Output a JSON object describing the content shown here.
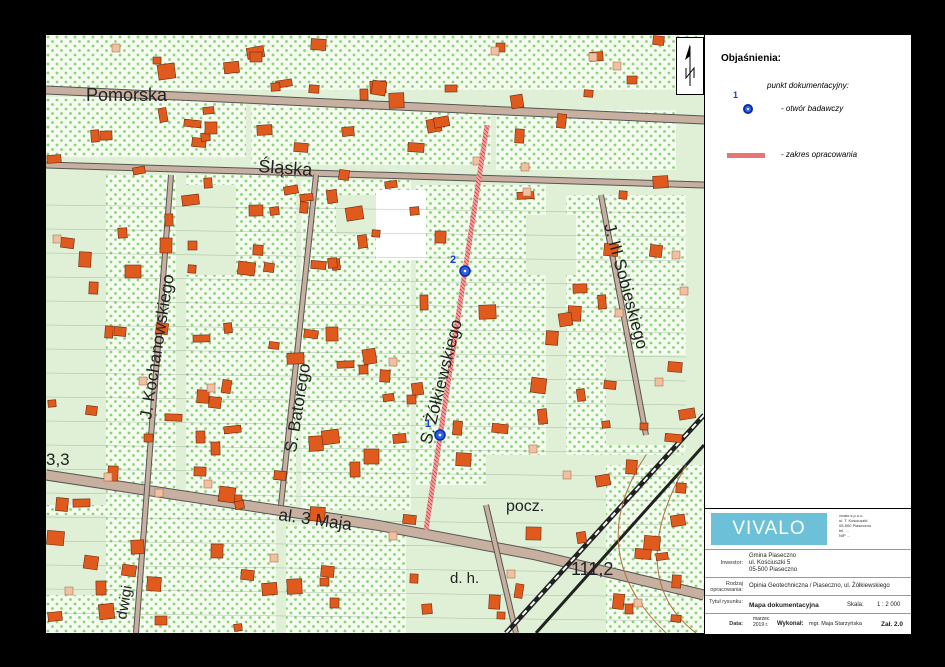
{
  "map": {
    "streets": {
      "pomorska": "Pomorska",
      "slaska": "Śląska",
      "kochanowskiego": "J. Kochanowskiego",
      "batorego": "S. Batorego",
      "zolkiewskiego": "S. Żółkiewskiego",
      "sobieskiego": "J. III Sobieskiego",
      "maja": "al. 3 Maja",
      "pocz": "pocz.",
      "dh": "d. h.",
      "elev1": "111,2",
      "elev2": "3,3",
      "ludwigi": "dwigi"
    },
    "points": [
      {
        "label": "1"
      },
      {
        "label": "2"
      }
    ],
    "colors": {
      "survey_line": "#e06060",
      "point": "#2d5fe0",
      "building": "#e05a1e",
      "road": "#c8b0a0",
      "green": "#dff0d6"
    }
  },
  "legend": {
    "title": "Objaśnienia:",
    "subtitle": "punkt dokumentacyjny:",
    "point_number": "1",
    "point_desc": "- otwór badawczy",
    "line_desc": "- zakres opracowania"
  },
  "titleblock": {
    "logo": "VIVALO",
    "company_lines": [
      "vivalo.s.p.o.o.",
      "ul. T. Kościuszki",
      "05-500 Piaseczno",
      "tel. ...",
      "NIP ..."
    ],
    "investor_label": "Inwestor:",
    "investor": [
      "Gmina Piaseczno",
      "ul. Kościuszki 5",
      "05-500 Piaseczno"
    ],
    "type_label": "Rodzaj opracowania:",
    "type": "Opinia Geotechniczna / Piaseczno, ul. Żółkiewskiego",
    "drawing_label": "Tytuł rysunku:",
    "drawing": "Mapa dokumentacyjna",
    "scale_label": "Skala:",
    "scale": "1 : 2 000",
    "date_label": "Data:",
    "date": [
      "marzec",
      "2019 r."
    ],
    "author_label": "Wykonał:",
    "author": "mgr. Maja Starzyńska",
    "sheet": "Zał. 2.0"
  }
}
